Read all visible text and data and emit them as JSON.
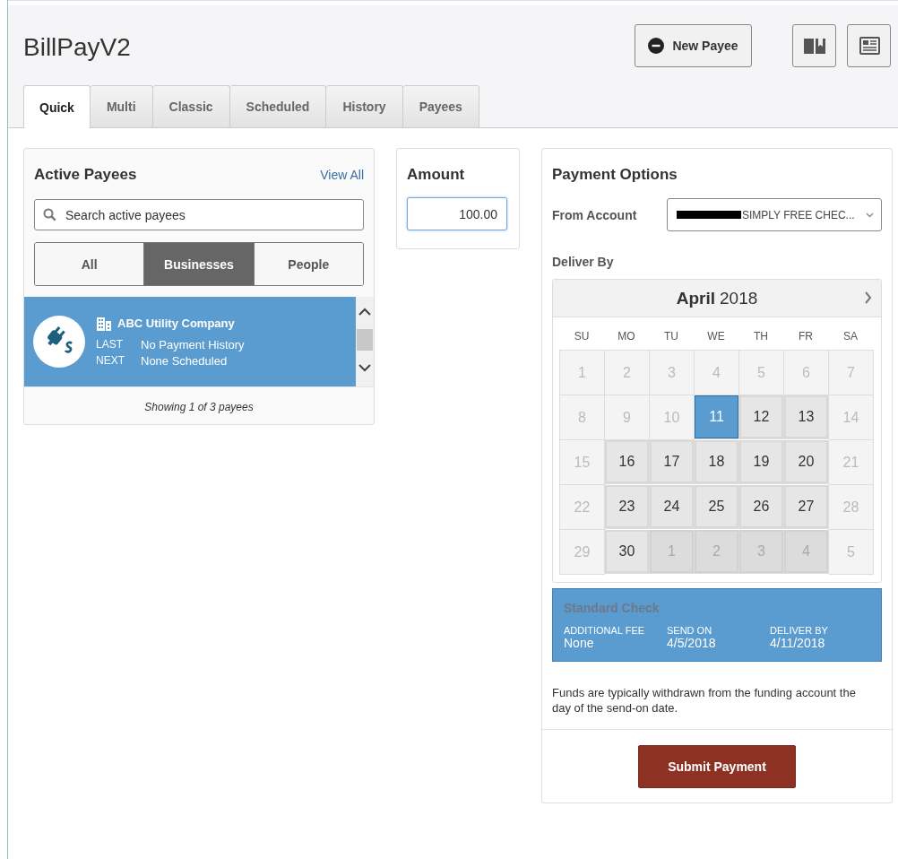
{
  "header": {
    "title": "BillPayV2",
    "new_payee_button": "New Payee"
  },
  "tabs": [
    {
      "label": "Quick",
      "selected": true
    },
    {
      "label": "Multi",
      "selected": false
    },
    {
      "label": "Classic",
      "selected": false
    },
    {
      "label": "Scheduled",
      "selected": false
    },
    {
      "label": "History",
      "selected": false
    },
    {
      "label": "Payees",
      "selected": false
    }
  ],
  "payees": {
    "title": "Active Payees",
    "view_all": "View All",
    "search": {
      "placeholder": "Search active payees"
    },
    "filters": [
      {
        "label": "All",
        "selected": false
      },
      {
        "label": "Businesses",
        "selected": true
      },
      {
        "label": "People",
        "selected": false
      }
    ],
    "items": [
      {
        "name": "ABC Utility Company",
        "last_label": "LAST",
        "last": "No Payment History",
        "next_label": "NEXT",
        "next": "None Scheduled",
        "selected": true
      }
    ],
    "footer": "Showing 1 of 3 payees"
  },
  "amount": {
    "title": "Amount",
    "value": "100.00"
  },
  "options": {
    "title": "Payment Options",
    "from_label": "From Account",
    "account": {
      "redacted": true,
      "text": "SIMPLY FREE CHEC..."
    },
    "deliver_label": "Deliver By",
    "calendar": {
      "month": "April",
      "year": "2018",
      "weekdays": [
        "SU",
        "MO",
        "TU",
        "WE",
        "TH",
        "FR",
        "SA"
      ],
      "days": [
        {
          "label": "1",
          "kind": "disabled",
          "selected": false
        },
        {
          "label": "2",
          "kind": "disabled",
          "selected": false
        },
        {
          "label": "3",
          "kind": "disabled",
          "selected": false
        },
        {
          "label": "4",
          "kind": "disabled",
          "selected": false
        },
        {
          "label": "5",
          "kind": "disabled",
          "selected": false
        },
        {
          "label": "6",
          "kind": "disabled",
          "selected": false
        },
        {
          "label": "7",
          "kind": "disabled",
          "selected": false
        },
        {
          "label": "8",
          "kind": "disabled",
          "selected": false
        },
        {
          "label": "9",
          "kind": "disabled",
          "selected": false
        },
        {
          "label": "10",
          "kind": "disabled",
          "selected": false
        },
        {
          "label": "11",
          "kind": "available",
          "selected": true
        },
        {
          "label": "12",
          "kind": "available",
          "selected": false
        },
        {
          "label": "13",
          "kind": "available",
          "selected": false
        },
        {
          "label": "14",
          "kind": "disabled",
          "selected": false
        },
        {
          "label": "15",
          "kind": "disabled",
          "selected": false
        },
        {
          "label": "16",
          "kind": "available",
          "selected": false
        },
        {
          "label": "17",
          "kind": "available",
          "selected": false
        },
        {
          "label": "18",
          "kind": "available",
          "selected": false
        },
        {
          "label": "19",
          "kind": "available",
          "selected": false
        },
        {
          "label": "20",
          "kind": "available",
          "selected": false
        },
        {
          "label": "21",
          "kind": "disabled",
          "selected": false
        },
        {
          "label": "22",
          "kind": "disabled",
          "selected": false
        },
        {
          "label": "23",
          "kind": "available",
          "selected": false
        },
        {
          "label": "24",
          "kind": "available",
          "selected": false
        },
        {
          "label": "25",
          "kind": "available",
          "selected": false
        },
        {
          "label": "26",
          "kind": "available",
          "selected": false
        },
        {
          "label": "27",
          "kind": "available",
          "selected": false
        },
        {
          "label": "28",
          "kind": "disabled",
          "selected": false
        },
        {
          "label": "29",
          "kind": "disabled",
          "selected": false
        },
        {
          "label": "30",
          "kind": "available",
          "selected": false
        },
        {
          "label": "1",
          "kind": "outside",
          "selected": false
        },
        {
          "label": "2",
          "kind": "outside",
          "selected": false
        },
        {
          "label": "3",
          "kind": "outside",
          "selected": false
        },
        {
          "label": "4",
          "kind": "outside",
          "selected": false
        },
        {
          "label": "5",
          "kind": "disabled",
          "selected": false
        }
      ]
    },
    "method": {
      "title": "Standard Check",
      "fields": [
        {
          "label": "ADDITIONAL FEE",
          "value": "None"
        },
        {
          "label": "SEND ON",
          "value": "4/5/2018"
        },
        {
          "label": "DELIVER BY",
          "value": "4/11/2018"
        }
      ]
    },
    "note": "Funds are typically withdrawn from the funding account the day of the send-on date.",
    "submit": "Submit Payment"
  }
}
